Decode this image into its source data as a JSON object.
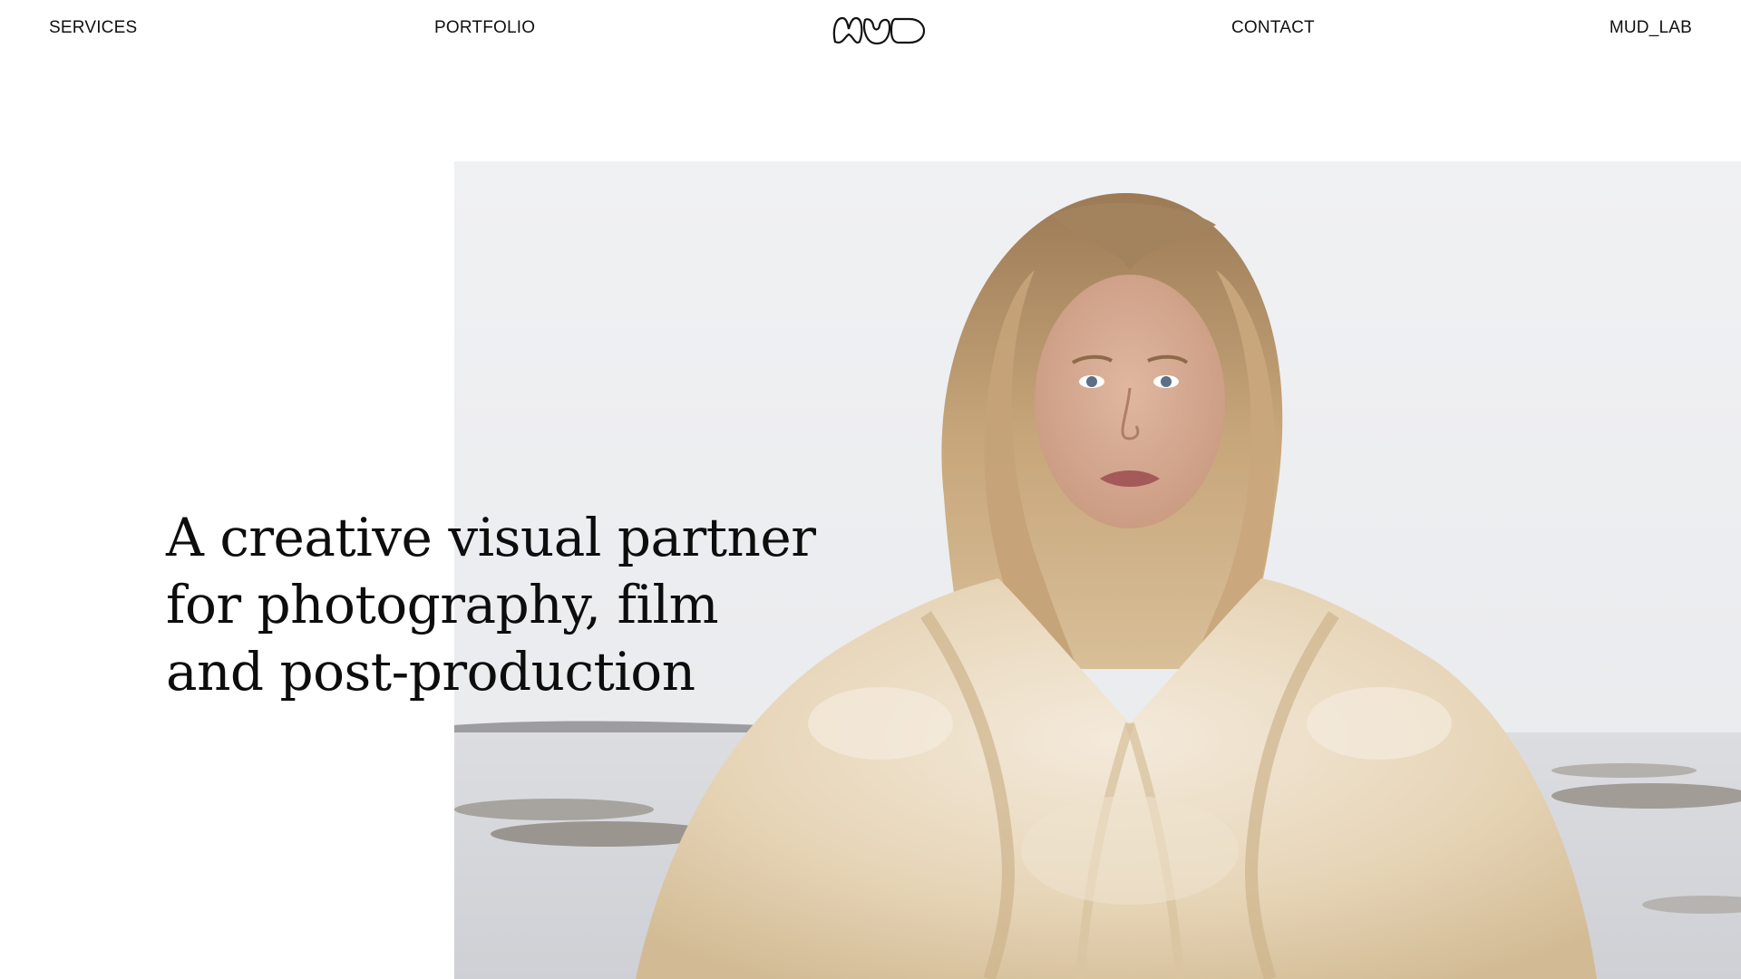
{
  "nav": {
    "services_label": "SERVICES",
    "portfolio_label": "PORTFOLIO",
    "contact_label": "CONTACT",
    "lab_label": "MUD_LAB"
  },
  "logo": {
    "text": "MUD",
    "icon": "mud-logo-icon"
  },
  "hero": {
    "headline": "A creative visual partner for photography, film and post-production",
    "image": "portrait of a blonde woman in a cream fur coat on a grey seashore"
  },
  "colors": {
    "text": "#0d0d0d",
    "background": "#ffffff",
    "sky": "#eeeff1",
    "fur": "#e9d9be"
  }
}
